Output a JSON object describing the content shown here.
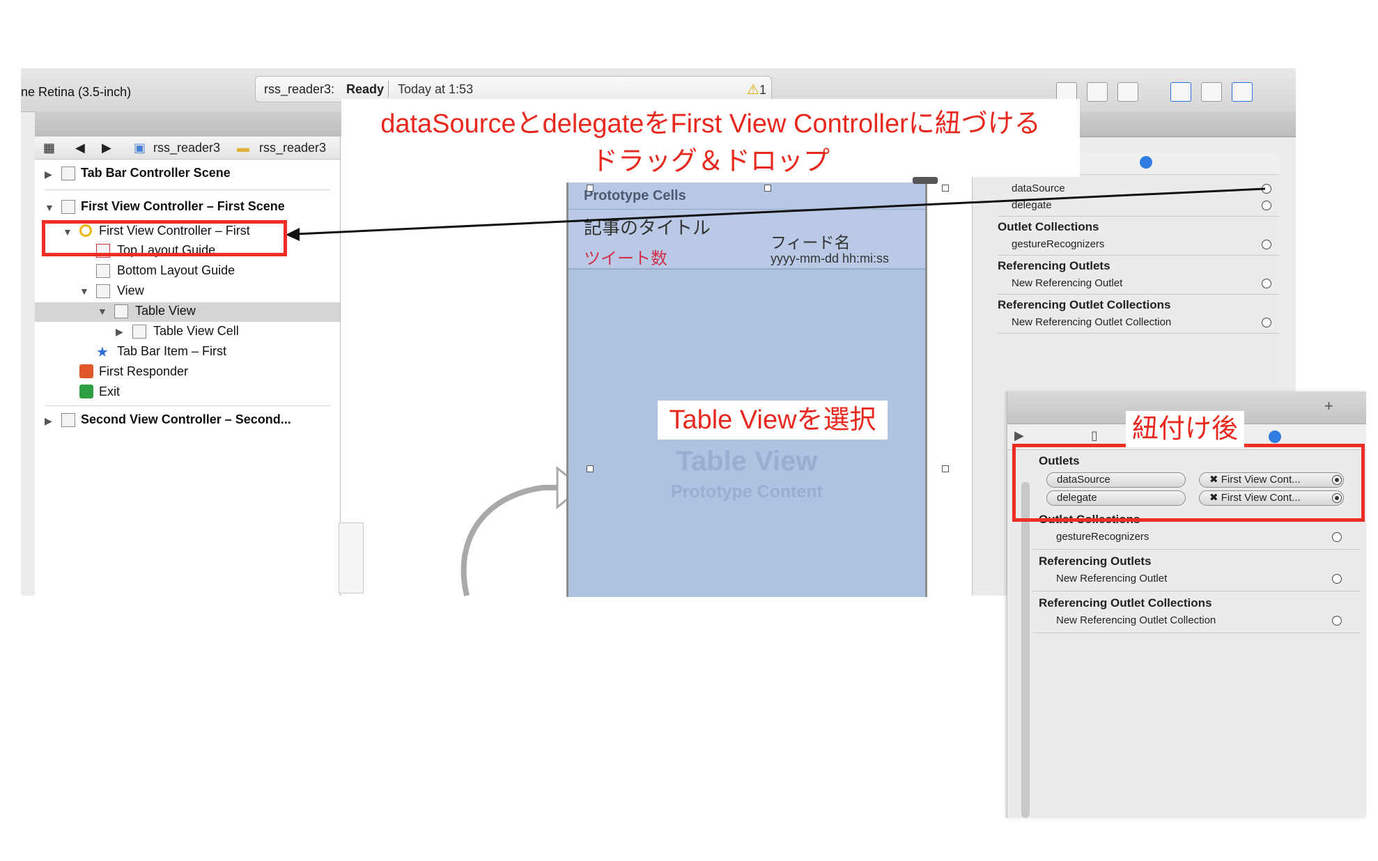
{
  "window": {
    "device_label": "ne Retina (3.5-inch)",
    "status": {
      "project": "rss_reader3:",
      "state": "Ready",
      "time": "Today at 1:53",
      "warning_count": "1"
    }
  },
  "jumpbar": {
    "crumb1": "rss_reader3",
    "crumb2": "rss_reader3"
  },
  "navigator": {
    "scene1": "Tab Bar Controller Scene",
    "scene2": "First View Controller – First Scene",
    "vc": "First View Controller – First",
    "top_guide": "Top Layout Guide",
    "bottom_guide": "Bottom Layout Guide",
    "view": "View",
    "table_view": "Table View",
    "table_cell": "Table View Cell",
    "tab_item": "Tab Bar Item – First",
    "first_responder": "First Responder",
    "exit": "Exit",
    "scene3": "Second View Controller – Second..."
  },
  "canvas": {
    "prototype_cells": "Prototype Cells",
    "cell_title": "記事のタイトル",
    "cell_feed": "フィード名",
    "cell_tweets": "ツイート数",
    "cell_date": "yyyy-mm-dd hh:mi:ss",
    "tv_watermark": "Table View",
    "tv_sub": "Prototype Content"
  },
  "inspector": {
    "datasource": "dataSource",
    "delegate": "delegate",
    "outlet_collections": "Outlet Collections",
    "gesture": "gestureRecognizers",
    "referencing_outlets": "Referencing Outlets",
    "new_ref_outlet": "New Referencing Outlet",
    "referencing_collections": "Referencing Outlet Collections",
    "new_ref_collection": "New Referencing Outlet Collection"
  },
  "after_panel": {
    "outlets": "Outlets",
    "datasource": "dataSource",
    "delegate": "delegate",
    "target1": "First View Cont...",
    "target2": "First View Cont...",
    "outlet_collections": "Outlet Collections",
    "gesture": "gestureRecognizers",
    "referencing_outlets": "Referencing Outlets",
    "new_ref_outlet": "New Referencing Outlet",
    "referencing_collections": "Referencing Outlet Collections",
    "new_ref_collection": "New Referencing Outlet Collection"
  },
  "annotations": {
    "banner_line1": "dataSourceとdelegateをFirst View Controllerに紐づける",
    "banner_line2": "ドラッグ＆ドロップ",
    "select_tv": "Table Viewを選択",
    "after_label": "紐付け後"
  },
  "colors": {
    "annotation_red": "#ef2d24",
    "table_bg": "#aec2e2",
    "tweet_red": "#d0304c"
  }
}
